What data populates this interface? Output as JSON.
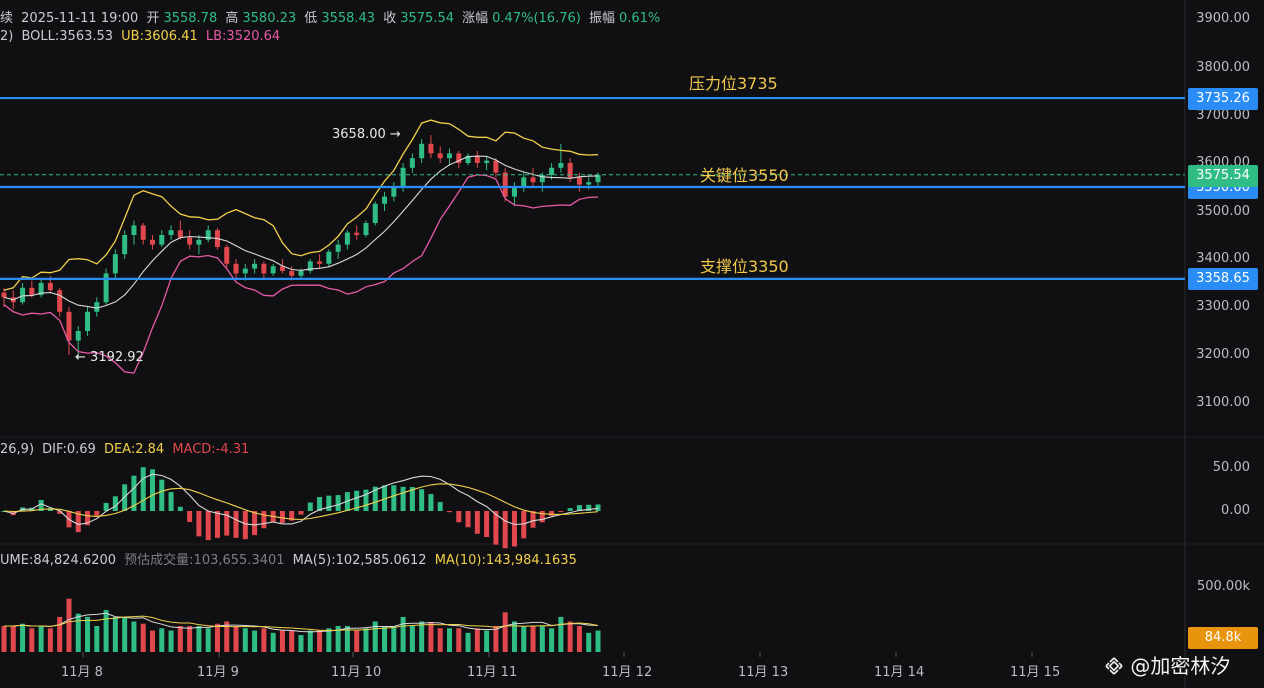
{
  "header": {
    "row1": {
      "prefix": "续",
      "datetime": "2025-11-11 19:00",
      "open_label": "开",
      "open": "3558.78",
      "high_label": "高",
      "high": "3580.23",
      "low_label": "低",
      "low": "3558.43",
      "close_label": "收",
      "close": "3575.54",
      "change_label": "涨幅",
      "change": "0.47%(16.76)",
      "amp_label": "振幅",
      "amp": "0.61%"
    },
    "row2": {
      "prefix": "2)",
      "boll": "BOLL:3563.53",
      "ub": "UB:3606.41",
      "lb": "LB:3520.64"
    },
    "row3": {
      "prefix": "26,9)",
      "dif": "DIF:0.69",
      "dea": "DEA:2.84",
      "macd": "MACD:-4.31"
    },
    "row4": {
      "volume": "UME:84,824.6200",
      "est": "预估成交量:103,655.3401",
      "ma5": "MA(5):102,585.0612",
      "ma10": "MA(10):143,984.1635"
    }
  },
  "price_axis": [
    "3900.00",
    "3800.00",
    "3735.26",
    "3700.00",
    "3600.00",
    "3575.54",
    "3500.00",
    "3400.00",
    "3358.65",
    "3300.00",
    "3200.00",
    "3100.00"
  ],
  "macd_axis": [
    "50.00",
    "0.00"
  ],
  "volume_axis": [
    "500.00k",
    "84.8k"
  ],
  "tags": {
    "resistance": "3735.26",
    "current": "3575.54",
    "support": "3358.65",
    "volume_current": "84.8k",
    "key_hidden": "3550.00"
  },
  "zones": {
    "resistance_label": "压力位3735",
    "key_label": "关键位3550",
    "support_label": "支撑位3350"
  },
  "annotations": {
    "high": "3658.00",
    "low": "3192.92"
  },
  "x_axis": [
    "11月 8",
    "11月 9",
    "11月 10",
    "11月 11",
    "11月 12",
    "11月 13",
    "11月 14",
    "11月 15"
  ],
  "watermark": "@加密林汐",
  "colors": {
    "bg": "#101013",
    "up": "#2fbd85",
    "down": "#e0484e",
    "ub": "#f0d04a",
    "lb": "#e85aa7",
    "mid": "#d8d8d8",
    "hline": "#2a8cf5",
    "zone_text": "#f2c94c",
    "vol_tag": "#e8940c"
  },
  "chart_data": {
    "type": "candlestick",
    "interval": "1h",
    "current_price": 3575.54,
    "key_levels": [
      3735.26,
      3550,
      3358.65
    ],
    "extremes": {
      "high": 3658.0,
      "low": 3192.92
    },
    "price_range": [
      3100,
      3900
    ],
    "candles_approx": [
      [
        3330,
        3340,
        3300,
        3320
      ],
      [
        3320,
        3335,
        3295,
        3310
      ],
      [
        3310,
        3350,
        3305,
        3340
      ],
      [
        3340,
        3355,
        3320,
        3325
      ],
      [
        3325,
        3360,
        3320,
        3350
      ],
      [
        3350,
        3365,
        3330,
        3335
      ],
      [
        3335,
        3340,
        3280,
        3290
      ],
      [
        3290,
        3300,
        3200,
        3230
      ],
      [
        3230,
        3260,
        3192.92,
        3250
      ],
      [
        3250,
        3300,
        3240,
        3290
      ],
      [
        3290,
        3320,
        3280,
        3310
      ],
      [
        3310,
        3380,
        3305,
        3370
      ],
      [
        3370,
        3420,
        3360,
        3410
      ],
      [
        3410,
        3460,
        3400,
        3450
      ],
      [
        3450,
        3480,
        3430,
        3470
      ],
      [
        3470,
        3475,
        3430,
        3440
      ],
      [
        3440,
        3450,
        3420,
        3430
      ],
      [
        3430,
        3460,
        3425,
        3450
      ],
      [
        3450,
        3470,
        3440,
        3460
      ],
      [
        3460,
        3480,
        3440,
        3445
      ],
      [
        3445,
        3460,
        3420,
        3430
      ],
      [
        3430,
        3450,
        3410,
        3440
      ],
      [
        3440,
        3470,
        3435,
        3460
      ],
      [
        3460,
        3465,
        3420,
        3425
      ],
      [
        3425,
        3430,
        3380,
        3390
      ],
      [
        3390,
        3400,
        3360,
        3370
      ],
      [
        3370,
        3390,
        3355,
        3380
      ],
      [
        3380,
        3400,
        3370,
        3390
      ],
      [
        3390,
        3395,
        3360,
        3370
      ],
      [
        3370,
        3390,
        3365,
        3385
      ],
      [
        3385,
        3400,
        3370,
        3375
      ],
      [
        3375,
        3385,
        3355,
        3365
      ],
      [
        3365,
        3380,
        3360,
        3375
      ],
      [
        3375,
        3400,
        3370,
        3395
      ],
      [
        3395,
        3410,
        3380,
        3390
      ],
      [
        3390,
        3420,
        3385,
        3415
      ],
      [
        3415,
        3440,
        3400,
        3430
      ],
      [
        3430,
        3460,
        3420,
        3455
      ],
      [
        3455,
        3470,
        3440,
        3450
      ],
      [
        3450,
        3480,
        3445,
        3475
      ],
      [
        3475,
        3520,
        3470,
        3515
      ],
      [
        3515,
        3540,
        3500,
        3530
      ],
      [
        3530,
        3560,
        3520,
        3550
      ],
      [
        3550,
        3600,
        3540,
        3590
      ],
      [
        3590,
        3620,
        3580,
        3610
      ],
      [
        3610,
        3650,
        3600,
        3640
      ],
      [
        3640,
        3658,
        3610,
        3620
      ],
      [
        3620,
        3635,
        3600,
        3610
      ],
      [
        3610,
        3630,
        3595,
        3620
      ],
      [
        3620,
        3625,
        3590,
        3600
      ],
      [
        3600,
        3620,
        3595,
        3615
      ],
      [
        3615,
        3625,
        3590,
        3600
      ],
      [
        3600,
        3615,
        3585,
        3605
      ],
      [
        3605,
        3610,
        3570,
        3580
      ],
      [
        3580,
        3590,
        3520,
        3530
      ],
      [
        3530,
        3560,
        3510,
        3550
      ],
      [
        3550,
        3580,
        3540,
        3570
      ],
      [
        3570,
        3590,
        3550,
        3560
      ],
      [
        3560,
        3580,
        3540,
        3575
      ],
      [
        3575,
        3600,
        3565,
        3590
      ],
      [
        3590,
        3640,
        3580,
        3600
      ],
      [
        3600,
        3610,
        3560,
        3570
      ],
      [
        3570,
        3580,
        3540,
        3555
      ],
      [
        3555,
        3570,
        3545,
        3560
      ],
      [
        3560,
        3580,
        3550,
        3575
      ]
    ],
    "boll": {
      "mid": 3563.53,
      "ub": 3606.41,
      "lb": 3520.64
    },
    "macd": {
      "dif": 0.69,
      "dea": 2.84,
      "macd": -4.31,
      "axis": [
        0,
        50
      ]
    },
    "volume": {
      "current": 84824.62,
      "estimated": 103655.3401,
      "ma5": 102585.0612,
      "ma10": 143984.1635,
      "axis_label": "500.00k"
    }
  }
}
